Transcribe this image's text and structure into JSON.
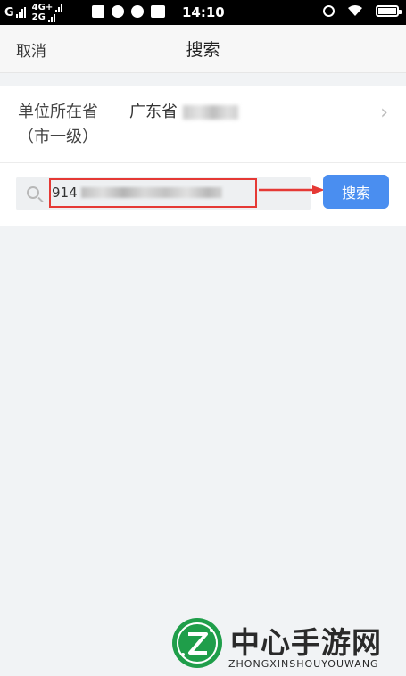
{
  "status_bar": {
    "carrier1": "G",
    "net_top": "4G+",
    "net_bottom": "2G",
    "time": "14:10",
    "icons": [
      "message-icon",
      "browser-icon",
      "weibo-icon",
      "video-icon",
      "alarm-icon",
      "wifi-icon",
      "battery-icon"
    ]
  },
  "header": {
    "cancel_label": "取消",
    "title": "搜索"
  },
  "province": {
    "label": "单位所在省（市一级）",
    "value": "广东省",
    "chevron": "›"
  },
  "search": {
    "value_prefix": "914",
    "button_label": "搜索"
  },
  "colors": {
    "accent": "#4a8ef0",
    "highlight": "#e53935",
    "watermark_green": "#1f9e4a"
  },
  "watermark": {
    "title": "中心手游网",
    "subtitle": "ZHONGXINSHOUYOUWANG"
  }
}
